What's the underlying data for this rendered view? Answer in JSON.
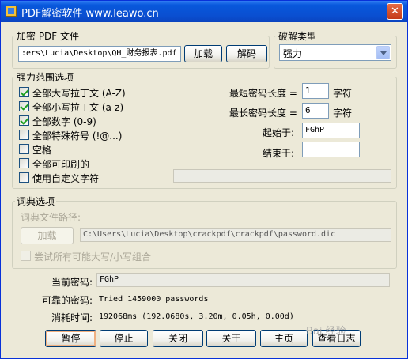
{
  "window": {
    "title": "PDF解密软件 www.leawo.cn",
    "close_label": "✕"
  },
  "file_group": {
    "label": "加密 PDF 文件",
    "path": ":ers\\Lucia\\Desktop\\QH_财务报表.pdf",
    "load_label": "加载",
    "decrypt_label": "解码"
  },
  "crack_type": {
    "label": "破解类型",
    "selected": "强力"
  },
  "brute_force": {
    "label": "强力范围选项",
    "options": [
      {
        "label": "全部大写拉丁文 (A-Z)",
        "checked": true
      },
      {
        "label": "全部小写拉丁文 (a-z)",
        "checked": true
      },
      {
        "label": "全部数字 (0-9)",
        "checked": true
      },
      {
        "label": "全部特殊符号 (!@...)",
        "checked": false
      },
      {
        "label": "空格",
        "checked": false
      },
      {
        "label": "全部可印刷的",
        "checked": false
      },
      {
        "label": "使用自定义字符",
        "checked": false
      }
    ],
    "min_length_label": "最短密码长度 =",
    "min_length_value": "1",
    "min_length_unit": "字符",
    "max_length_label": "最长密码长度 =",
    "max_length_value": "6",
    "max_length_unit": "字符",
    "start_label": "起始于:",
    "start_value": "FGhP",
    "end_label": "结束于:",
    "end_value": ""
  },
  "dictionary": {
    "label": "词典选项",
    "path_label": "词典文件路径:",
    "load_label": "加载",
    "path_value": "C:\\Users\\Lucia\\Desktop\\crackpdf\\crackpdf\\password.dic",
    "case_combo_label": "尝试所有可能大写/小写组合"
  },
  "status": {
    "current_label": "当前密码:",
    "current_value": "FGhP",
    "possible_label": "可靠的密码:",
    "possible_value": "Tried 1459000 passwords",
    "elapsed_label": "消耗时间:",
    "elapsed_value": "192068ms (192.0680s, 3.20m, 0.05h, 0.00d)"
  },
  "buttons": {
    "pause": "暂停",
    "stop": "停止",
    "close": "关闭",
    "about": "关于",
    "home": "主页",
    "log": "查看日志"
  },
  "watermark": "Bai 经验"
}
